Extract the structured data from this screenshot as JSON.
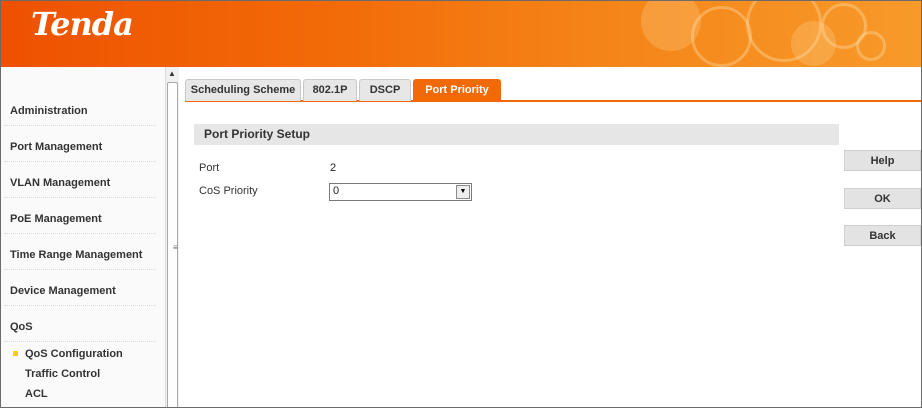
{
  "header": {
    "logo_text": "Tenda",
    "brand_color": "#f26a08"
  },
  "sidebar": {
    "items": [
      {
        "label": "Administration"
      },
      {
        "label": "Port Management"
      },
      {
        "label": "VLAN Management"
      },
      {
        "label": "PoE Management"
      },
      {
        "label": "Time Range Management"
      },
      {
        "label": "Device Management"
      },
      {
        "label": "QoS"
      }
    ],
    "sub_items": [
      {
        "label": "QoS Configuration",
        "active": true
      },
      {
        "label": "Traffic Control"
      },
      {
        "label": "ACL"
      }
    ]
  },
  "tabs": [
    {
      "label": "Scheduling Scheme"
    },
    {
      "label": "802.1P"
    },
    {
      "label": "DSCP"
    },
    {
      "label": "Port Priority",
      "active": true
    }
  ],
  "panel": {
    "title": "Port Priority Setup",
    "port_label": "Port",
    "port_value": "2",
    "cos_label": "CoS Priority",
    "cos_value": "0"
  },
  "buttons": {
    "help": "Help",
    "ok": "OK",
    "back": "Back"
  }
}
